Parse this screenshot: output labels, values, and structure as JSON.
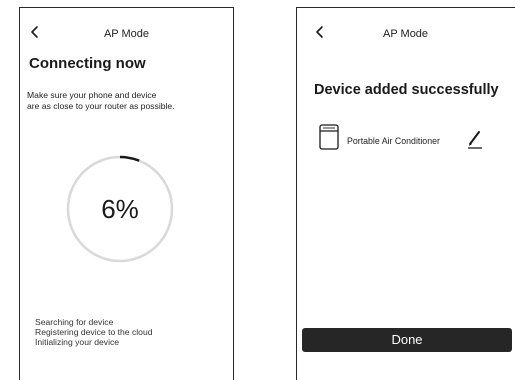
{
  "connecting_screen": {
    "nav_title": "AP Mode",
    "heading": "Connecting now",
    "instruction_lines": [
      "Make sure your phone and device",
      "are as close to your router as possible."
    ],
    "progress": {
      "text": "6%",
      "value_percent": 6
    },
    "steps": [
      "Searching for device",
      "Registering device to the cloud",
      "Initializing your device"
    ]
  },
  "success_screen": {
    "nav_title": "AP Mode",
    "heading": "Device added successfully",
    "device": {
      "name": "Portable Air Conditioner",
      "icon": "air-conditioner-icon",
      "edit_icon": "pencil-icon"
    },
    "done_label": "Done"
  },
  "colors": {
    "ring_track": "#d9d9d9",
    "ring_progress": "#1a1a1a",
    "button_background": "#262626",
    "button_text": "#ffffff"
  }
}
